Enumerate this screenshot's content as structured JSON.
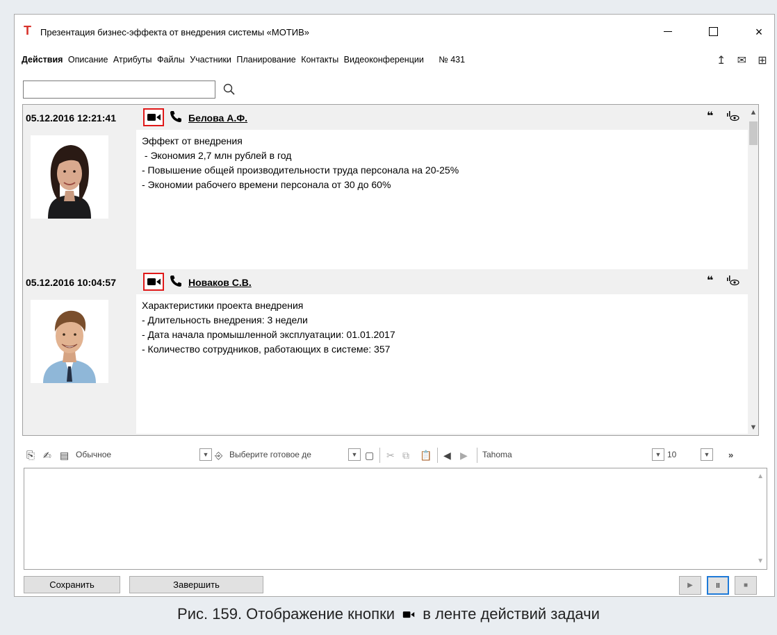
{
  "window": {
    "title": "Презентация бизнес-эффекта от внедрения системы «МОТИВ»",
    "logo_glyph": "Т",
    "min_icon": "minimize-icon",
    "max_icon": "maximize-icon",
    "close_label": "×"
  },
  "tabs": [
    {
      "label": "Действия",
      "active": true
    },
    {
      "label": "Описание"
    },
    {
      "label": "Атрибуты"
    },
    {
      "label": "Файлы"
    },
    {
      "label": "Участники"
    },
    {
      "label": "Планирование"
    },
    {
      "label": "Контакты"
    },
    {
      "label": "Видеоконференции"
    }
  ],
  "task_number": "№ 431",
  "search": {
    "value": "",
    "placeholder": ""
  },
  "entries": [
    {
      "date": "05.12.2016 12:21:41",
      "author": "Белова А.Ф.",
      "text": "Эффект от внедрения\n - Экономия 2,7 млн рублей в год\n- Повышение общей производительности труда персонала на 20-25%\n- Экономии рабочего времени персонала от 30 до 60%"
    },
    {
      "date": "05.12.2016 10:04:57",
      "author": "Новаков С.В.",
      "text": "Характеристики проекта внедрения\n- Длительность внедрения: 3 недели\n- Дата начала промышленной эксплуатации: 01.01.2017\n- Количество сотрудников, работающих в системе: 357"
    }
  ],
  "editor": {
    "style_value": "Обычное",
    "template_value": "Выберите готовое де",
    "font_value": "Tahoma",
    "size_value": "10"
  },
  "buttons": {
    "save": "Сохранить",
    "finish": "Завершить"
  },
  "caption": {
    "before": "Рис. 159. Отображение кнопки",
    "after": "в ленте действий задачи"
  },
  "colors": {
    "highlight": "#e01818",
    "logo": "#d8322b",
    "active_focus": "#1e7ad8"
  }
}
